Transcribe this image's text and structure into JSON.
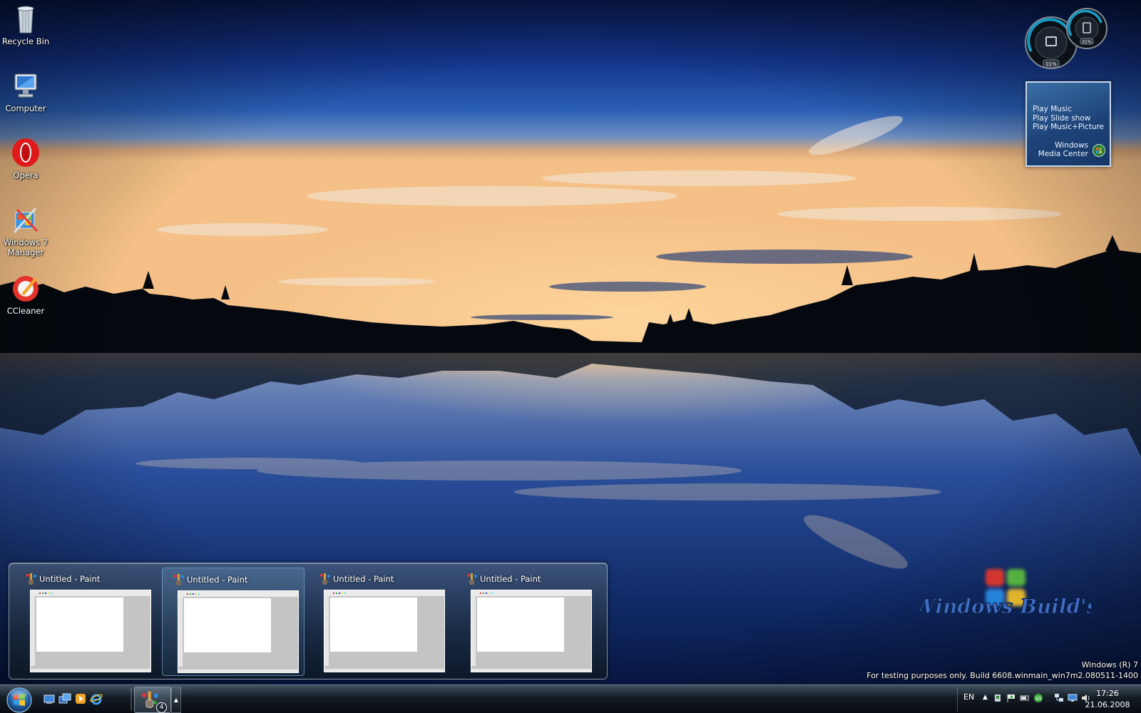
{
  "desktop": {
    "icons": [
      {
        "label": "Recycle Bin",
        "icon": "recycle-bin-icon"
      },
      {
        "label": "Computer",
        "icon": "computer-icon"
      },
      {
        "label": "Opera",
        "icon": "opera-icon"
      },
      {
        "label": "Windows 7\nManager",
        "icon": "windows7-manager-icon"
      },
      {
        "label": "CCleaner",
        "icon": "ccleaner-icon"
      }
    ]
  },
  "gadgets": {
    "meters": {
      "cpu": "01%",
      "memory": "41%"
    },
    "media_center": {
      "links": [
        "Play Music",
        "Play Slide show",
        "Play Music+Picture"
      ],
      "brand": "Windows\nMedia Center"
    }
  },
  "thumbnails": {
    "items": [
      {
        "title": "Untitled - Paint",
        "icon": "paint-icon"
      },
      {
        "title": "Untitled - Paint",
        "icon": "paint-icon"
      },
      {
        "title": "Untitled - Paint",
        "icon": "paint-icon"
      },
      {
        "title": "Untitled - Paint",
        "icon": "paint-icon"
      }
    ],
    "hovered_index": 1
  },
  "watermark": {
    "logo_text": "Windows Build's",
    "os_line": "Windows (R) 7",
    "build_line": "For testing purposes only. Build 6608.winmain_win7m2.080511-1400"
  },
  "taskbar": {
    "paint_group_count": "4",
    "language": "EN",
    "time": "17:26",
    "date": "21.06.2008",
    "quick_launch": [
      "show-desktop-icon",
      "switch-windows-icon",
      "media-player-icon",
      "internet-explorer-icon"
    ],
    "tray": [
      "tray-app-icon",
      "tray-flag-icon",
      "tray-battery-icon",
      "tray-update-icon",
      "network-icon",
      "display-icon",
      "volume-icon"
    ]
  },
  "colors": {
    "sky_top": "#0a1a4f",
    "sky_mid": "#2a5db0",
    "sunset": "#f0b070",
    "taskbar": "#111820",
    "gadget_blue": "#1d4378"
  }
}
